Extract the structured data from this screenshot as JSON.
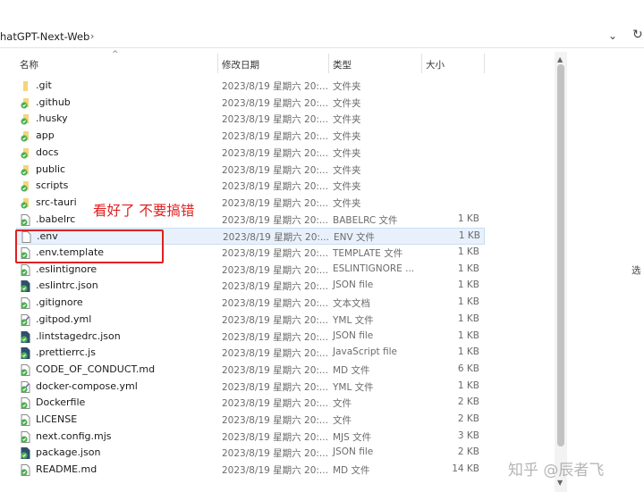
{
  "address": {
    "crumb": "hatGPT-Next-Web",
    "separator": "›",
    "dropdown": "⌄",
    "refresh": "↻"
  },
  "columns": {
    "name": "名称",
    "modified": "修改日期",
    "type": "类型",
    "size": "大小"
  },
  "annotation": {
    "text": "看好了 不要搞错"
  },
  "right_edge_text": "选",
  "watermark": "知乎 @辰者飞",
  "colors": {
    "annotation": "#e02020",
    "selection": "#e8f1fb",
    "folder": "#f5d47a"
  },
  "files": [
    {
      "name": ".git",
      "date": "2023/8/19 星期六 20:...",
      "type": "文件夹",
      "size": "",
      "icon": "folder-icon"
    },
    {
      "name": ".github",
      "date": "2023/8/19 星期六 20:...",
      "type": "文件夹",
      "size": "",
      "icon": "folder-sync-icon"
    },
    {
      "name": ".husky",
      "date": "2023/8/19 星期六 20:...",
      "type": "文件夹",
      "size": "",
      "icon": "folder-sync-icon"
    },
    {
      "name": "app",
      "date": "2023/8/19 星期六 20:...",
      "type": "文件夹",
      "size": "",
      "icon": "folder-sync-icon"
    },
    {
      "name": "docs",
      "date": "2023/8/19 星期六 20:...",
      "type": "文件夹",
      "size": "",
      "icon": "folder-sync-icon"
    },
    {
      "name": "public",
      "date": "2023/8/19 星期六 20:...",
      "type": "文件夹",
      "size": "",
      "icon": "folder-sync-icon"
    },
    {
      "name": "scripts",
      "date": "2023/8/19 星期六 20:...",
      "type": "文件夹",
      "size": "",
      "icon": "folder-sync-icon"
    },
    {
      "name": "src-tauri",
      "date": "2023/8/19 星期六 20:...",
      "type": "文件夹",
      "size": "",
      "icon": "folder-sync-icon"
    },
    {
      "name": ".babelrc",
      "date": "2023/8/19 星期六 20:...",
      "type": "BABELRC 文件",
      "size": "1 KB",
      "icon": "file-sync-icon"
    },
    {
      "name": ".env",
      "date": "2023/8/19 星期六 20:...",
      "type": "ENV 文件",
      "size": "1 KB",
      "icon": "file-icon"
    },
    {
      "name": ".env.template",
      "date": "2023/8/19 星期六 20:...",
      "type": "TEMPLATE 文件",
      "size": "1 KB",
      "icon": "file-sync-icon"
    },
    {
      "name": ".eslintignore",
      "date": "2023/8/19 星期六 20:...",
      "type": "ESLINTIGNORE ...",
      "size": "1 KB",
      "icon": "file-sync-icon"
    },
    {
      "name": ".eslintrc.json",
      "date": "2023/8/19 星期六 20:...",
      "type": "JSON file",
      "size": "1 KB",
      "icon": "file-dark-icon"
    },
    {
      "name": ".gitignore",
      "date": "2023/8/19 星期六 20:...",
      "type": "文本文档",
      "size": "1 KB",
      "icon": "file-sync-icon"
    },
    {
      "name": ".gitpod.yml",
      "date": "2023/8/19 星期六 20:...",
      "type": "YML 文件",
      "size": "1 KB",
      "icon": "file-edit-icon"
    },
    {
      "name": ".lintstagedrc.json",
      "date": "2023/8/19 星期六 20:...",
      "type": "JSON file",
      "size": "1 KB",
      "icon": "file-dark-icon"
    },
    {
      "name": ".prettierrc.js",
      "date": "2023/8/19 星期六 20:...",
      "type": "JavaScript file",
      "size": "1 KB",
      "icon": "file-dark-icon"
    },
    {
      "name": "CODE_OF_CONDUCT.md",
      "date": "2023/8/19 星期六 20:...",
      "type": "MD 文件",
      "size": "6 KB",
      "icon": "file-sync-icon"
    },
    {
      "name": "docker-compose.yml",
      "date": "2023/8/19 星期六 20:...",
      "type": "YML 文件",
      "size": "1 KB",
      "icon": "file-edit-icon"
    },
    {
      "name": "Dockerfile",
      "date": "2023/8/19 星期六 20:...",
      "type": "文件",
      "size": "2 KB",
      "icon": "file-sync-icon"
    },
    {
      "name": "LICENSE",
      "date": "2023/8/19 星期六 20:...",
      "type": "文件",
      "size": "2 KB",
      "icon": "file-sync-icon"
    },
    {
      "name": "next.config.mjs",
      "date": "2023/8/19 星期六 20:...",
      "type": "MJS 文件",
      "size": "3 KB",
      "icon": "file-sync-icon"
    },
    {
      "name": "package.json",
      "date": "2023/8/19 星期六 20:...",
      "type": "JSON file",
      "size": "2 KB",
      "icon": "file-dark-icon"
    },
    {
      "name": "README.md",
      "date": "2023/8/19 星期六 20:...",
      "type": "MD 文件",
      "size": "14 KB",
      "icon": "file-sync-icon"
    }
  ]
}
